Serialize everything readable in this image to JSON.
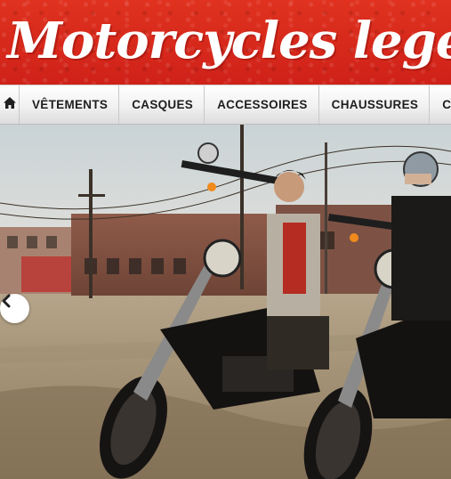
{
  "banner": {
    "title": "Motorcycles legend s"
  },
  "nav": {
    "home_icon": "home-icon",
    "items": [
      {
        "label": "VÊTEMENTS"
      },
      {
        "label": "CASQUES"
      },
      {
        "label": "ACCESSOIRES"
      },
      {
        "label": "CHAUSSURES"
      },
      {
        "label": "CA"
      }
    ]
  },
  "hero": {
    "image": "two riders seated on black motorcycles on a dirt lot in front of brick industrial buildings under a pale sky",
    "prev_icon": "chevron-left-icon"
  },
  "colors": {
    "banner_red": "#d8261c",
    "nav_text": "#1e1e1e",
    "banner_text": "#ffffff"
  }
}
